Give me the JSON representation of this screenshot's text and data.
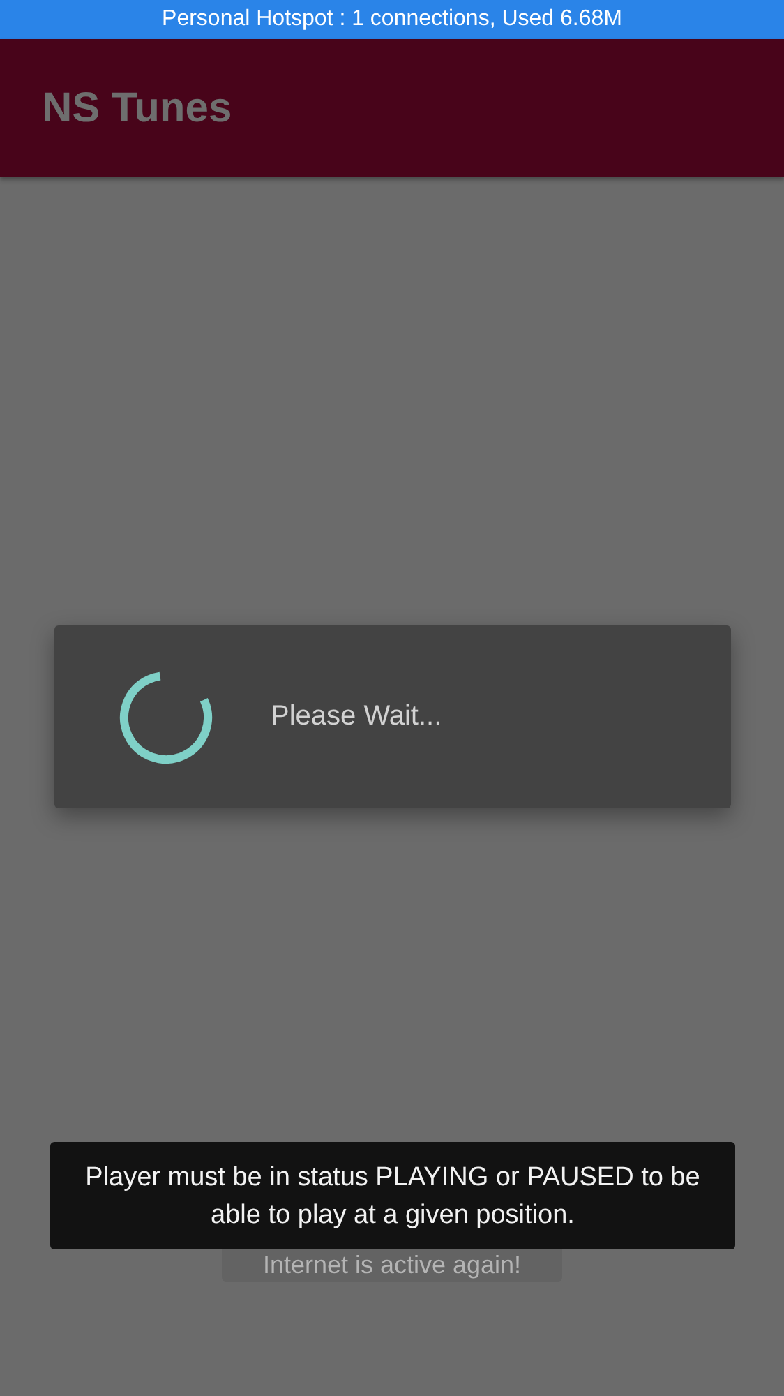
{
  "status_bar": {
    "text": "Personal Hotspot : 1 connections, Used 6.68M"
  },
  "app_bar": {
    "title": "NS Tunes"
  },
  "dialog": {
    "message": "Please Wait..."
  },
  "toasts": [
    {
      "kind": "solid",
      "text": "Player must be in status PLAYING or PAUSED to be able to play at a given position."
    },
    {
      "kind": "faded",
      "text": "Internet is active again!"
    }
  ]
}
